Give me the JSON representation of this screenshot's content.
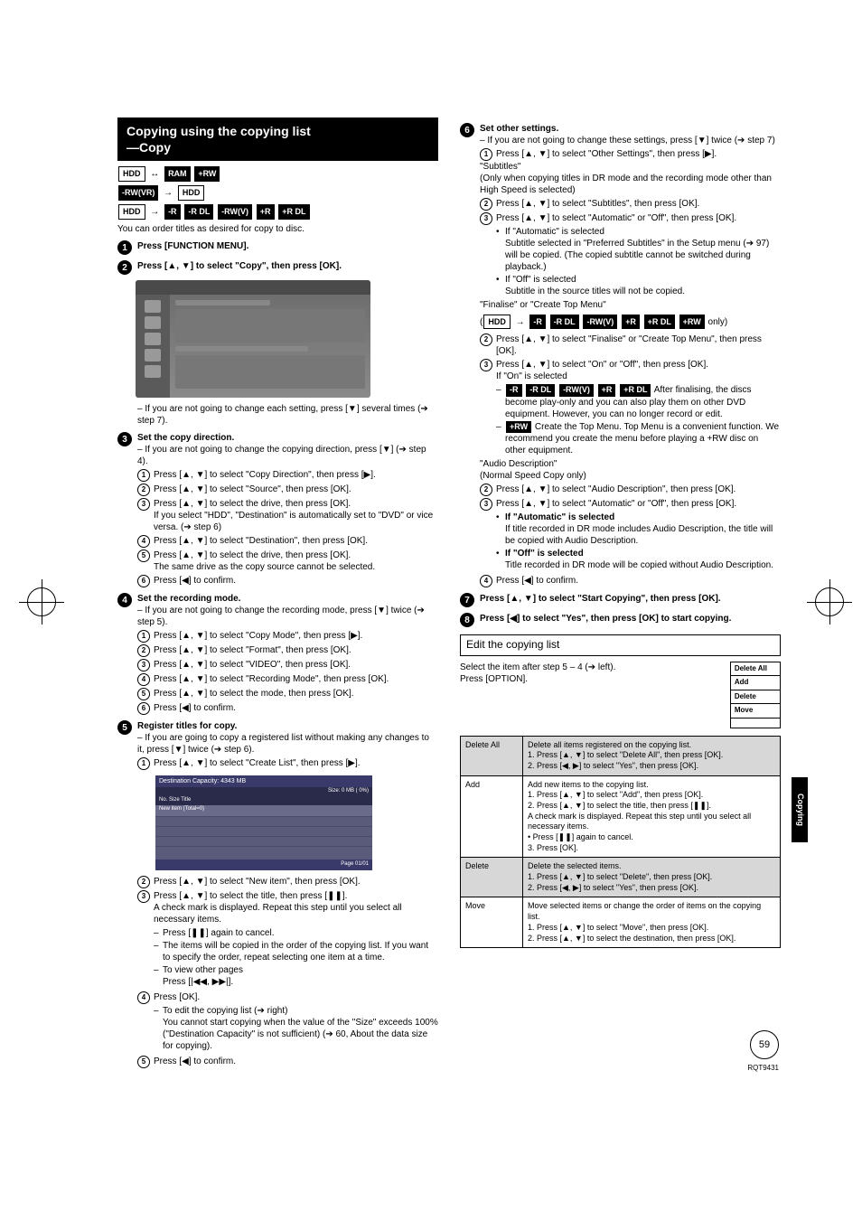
{
  "section_title": "Copying using the copying list\n—Copy",
  "badges_line1": {
    "a": "HDD",
    "b": "RAM",
    "c": "+RW"
  },
  "badges_line2": {
    "a": "-RW(VR)",
    "b": "HDD"
  },
  "badges_line3": {
    "a": "HDD",
    "b": "-R",
    "c": "-R DL",
    "d": "-RW(V)",
    "e": "+R",
    "f": "+R DL"
  },
  "intro_order": "You can order titles as desired for copy to disc.",
  "step1": {
    "num": "1",
    "text": "Press [FUNCTION MENU]."
  },
  "step2": {
    "num": "2",
    "text": "Press [▲, ▼] to select \"Copy\", then press [OK]."
  },
  "sshot_note": "– If you are not going to change each setting, press [▼] several times (➔ step 7).",
  "step3": {
    "num": "3",
    "title": "Set the copy direction.",
    "note": "– If you are not going to change the copying direction, press [▼] (➔ step 4).",
    "s1": "Press [▲, ▼] to select \"Copy Direction\", then press [▶].",
    "s2": "Press [▲, ▼] to select \"Source\", then press [OK].",
    "s3": "Press [▲, ▼] to select the drive, then press [OK].",
    "s3b": "If you select \"HDD\", \"Destination\" is automatically set to \"DVD\" or vice versa. (➔ step 6)",
    "s4": "Press [▲, ▼] to select \"Destination\", then press [OK].",
    "s5": "Press [▲, ▼] to select the drive, then press [OK].",
    "s5b": "The same drive as the copy source cannot be selected.",
    "s6": "Press [◀] to confirm."
  },
  "step4": {
    "num": "4",
    "title": "Set the recording mode.",
    "note": "– If you are not going to change the recording mode, press [▼] twice (➔ step 5).",
    "s1": "Press [▲, ▼] to select \"Copy Mode\", then press [▶].",
    "s2": "Press [▲, ▼] to select \"Format\", then press [OK].",
    "s3": "Press [▲, ▼] to select \"VIDEO\", then press [OK].",
    "s4": "Press [▲, ▼] to select \"Recording Mode\", then press [OK].",
    "s5": "Press [▲, ▼] to select the mode, then press [OK].",
    "s6": "Press [◀] to confirm."
  },
  "step5": {
    "num": "5",
    "title": "Register titles for copy.",
    "note": "– If you are going to copy a registered list without making any changes to it, press [▼] twice (➔ step 6).",
    "s1": "Press [▲, ▼] to select \"Create List\", then press [▶].",
    "list_hdr": "Destination Capacity:  4343 MB",
    "list_sub": "Size:            0 MB ( 0%)",
    "list_cols": "No.      Size             Title",
    "list_new": "New item (Total=0)",
    "list_page": "Page 01/01",
    "s2": "Press [▲, ▼] to select \"New item\", then press [OK].",
    "s3": "Press [▲, ▼] to select the title, then press [❚❚].",
    "s3b": "A check mark is displayed. Repeat this step until you select all necessary items.",
    "d1": "Press [❚❚] again to cancel.",
    "d2": "The items will be copied in the order of the copying list. If you want to specify the order, repeat selecting one item at a time.",
    "d3": "To view other pages",
    "d3b": "Press [|◀◀, ▶▶|].",
    "s4": "Press [OK].",
    "s4b": "To edit the copying list (➔ right)",
    "s4c": "You cannot start copying when the value of the \"Size\" exceeds 100% (\"Destination Capacity\" is not sufficient) (➔ 60, About the data size for copying).",
    "s5": "Press [◀] to confirm."
  },
  "step6": {
    "num": "6",
    "title": "Set other settings.",
    "note": "– If you are not going to change these settings, press [▼] twice (➔ step 7)",
    "s1": "Press [▲, ▼] to select \"Other Settings\", then press [▶].",
    "subtitles_hdr": "\"Subtitles\"",
    "subtitles_note": "(Only when copying titles in DR mode and the recording mode other than High Speed is selected)",
    "s2": "Press [▲, ▼] to select \"Subtitles\", then press [OK].",
    "s3": "Press [▲, ▼] to select \"Automatic\" or \"Off\", then press [OK].",
    "auto_hdr": "If \"Automatic\" is selected",
    "auto_body": "Subtitle selected in \"Preferred Subtitles\" in the Setup menu (➔ 97) will be copied. (The copied subtitle cannot be switched during playback.)",
    "off_hdr": "If \"Off\" is selected",
    "off_body": "Subtitle in the source titles will not be copied.",
    "finalise_hdr": "\"Finalise\" or \"Create Top Menu\"",
    "finalise_badges": {
      "a": "HDD",
      "b": "-R",
      "c": "-R DL",
      "d": "-RW(V)",
      "e": "+R",
      "f": "+R DL",
      "g": "+RW",
      "suffix": " only)"
    },
    "f_s2": "Press [▲, ▼] to select \"Finalise\" or \"Create Top Menu\", then press [OK].",
    "f_s3": "Press [▲, ▼] to select \"On\" or \"Off\", then press [OK].",
    "f_on_hdr": "If \"On\" is selected",
    "f_on1_badges": {
      "a": "-R",
      "b": "-R DL",
      "c": "-RW(V)",
      "d": "+R",
      "e": "+R DL"
    },
    "f_on1_text": " After finalising, the discs become play-only and you can also play them on other DVD equipment. However, you can no longer record or edit.",
    "f_on2_badge": "+RW",
    "f_on2_text": " Create the Top Menu. Top Menu is a convenient function. We recommend you create the menu before playing a +RW disc on other equipment.",
    "audio_hdr": "\"Audio Description\"",
    "audio_note": "(Normal Speed Copy only)",
    "a_s2": "Press [▲, ▼] to select \"Audio Description\", then press [OK].",
    "a_s3": "Press [▲, ▼] to select \"Automatic\" or \"Off\", then press [OK].",
    "a_auto_hdr": "If \"Automatic\" is selected",
    "a_auto_body": "If title recorded in DR mode includes Audio Description, the title will be copied with Audio Description.",
    "a_off_hdr": "If \"Off\" is selected",
    "a_off_body": "Title recorded in DR mode will be copied without Audio Description.",
    "s4": "Press [◀] to confirm."
  },
  "step7": {
    "num": "7",
    "text": "Press [▲, ▼] to select \"Start Copying\", then press [OK]."
  },
  "step8": {
    "num": "8",
    "text": "Press [◀] to select \"Yes\", then press [OK] to start copying."
  },
  "edit_title": "Edit the copying list",
  "edit_intro": "Select the item after step 5 – 4 (➔ left).\nPress [OPTION].",
  "option_menu": {
    "a": "Delete All",
    "b": "Add",
    "c": "Delete",
    "d": "Move"
  },
  "table": {
    "r1h": "Delete All",
    "r1": "Delete all items registered on the copying list.\n1. Press [▲, ▼] to select \"Delete All\", then press [OK].\n2. Press [◀, ▶] to select \"Yes\", then press [OK].",
    "r2h": "Add",
    "r2": "Add new items to the copying list.\n1. Press [▲, ▼] to select \"Add\", then press [OK].\n2. Press [▲, ▼] to select the title, then press [❚❚].\n   A check mark is displayed. Repeat this step until you select all necessary items.\n   • Press [❚❚] again to cancel.\n3. Press [OK].",
    "r3h": "Delete",
    "r3": "Delete the selected items.\n1. Press [▲, ▼] to select \"Delete\", then press [OK].\n2. Press [◀, ▶] to select \"Yes\", then press [OK].",
    "r4h": "Move",
    "r4": "Move selected items or change the order of items on the copying list.\n1. Press [▲, ▼] to select \"Move\", then press [OK].\n2. Press [▲, ▼] to select the destination, then press [OK]."
  },
  "side_tab": "Copying",
  "page_num": "59",
  "footer_code": "RQT9431"
}
